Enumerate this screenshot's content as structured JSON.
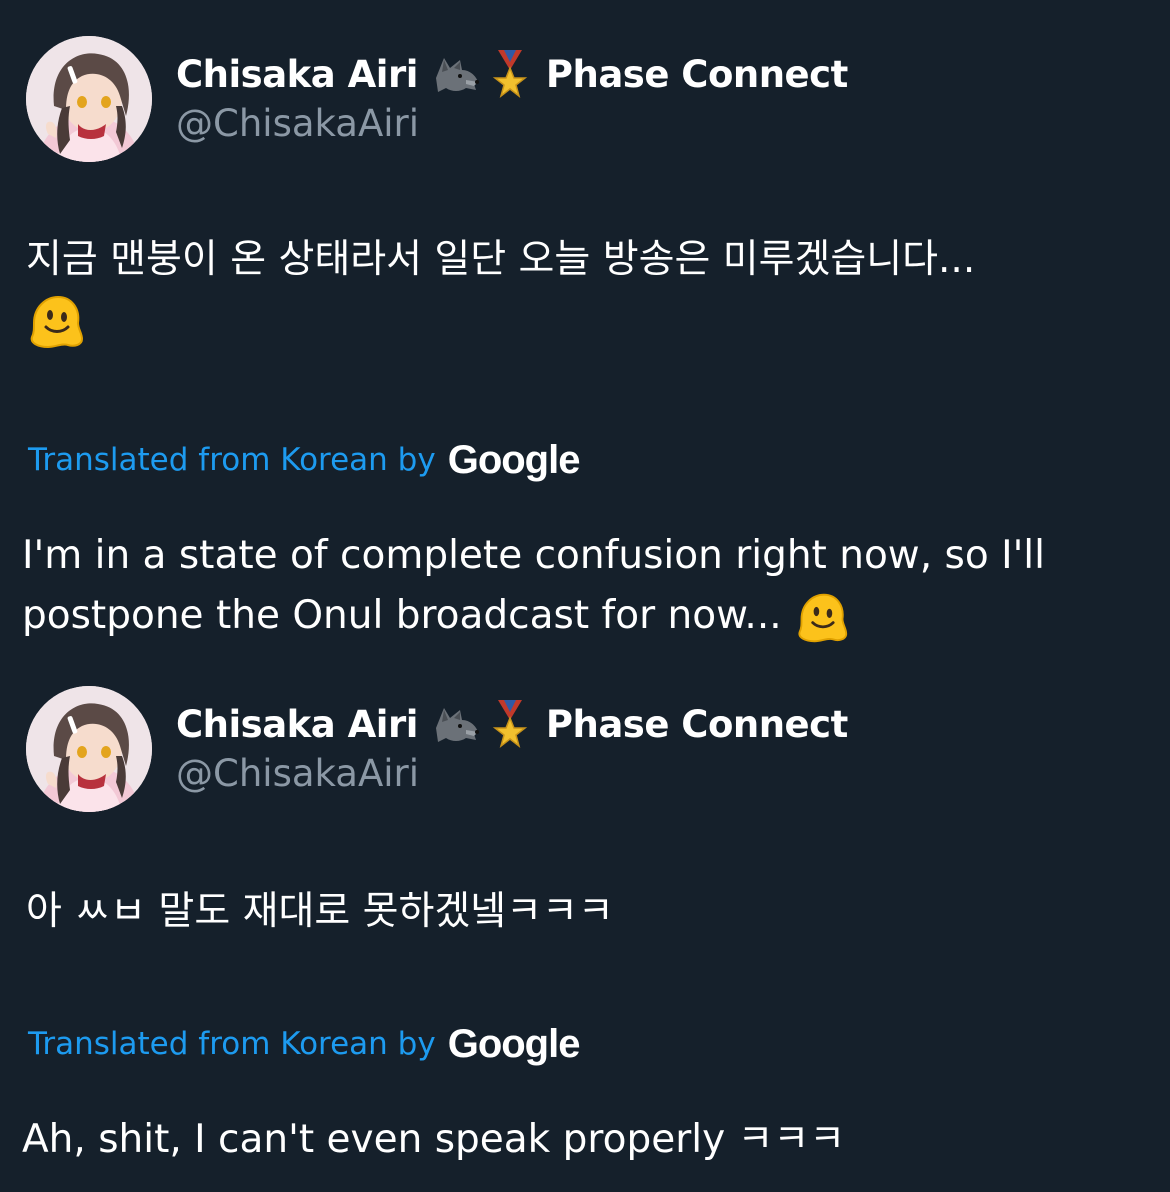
{
  "tweets": [
    {
      "author": {
        "display_name": "Chisaka Airi",
        "badge_icons": [
          "wolf-emoji-icon",
          "military-medal-icon"
        ],
        "affiliation": "Phase Connect",
        "handle": "@ChisakaAiri"
      },
      "original_text": "지금 맨붕이 온 상태라서 일단 오늘 방송은 미루겠습니다...",
      "original_emoji": "melting-face-icon",
      "translation_label": "Translated from Korean by",
      "translation_provider": "Google",
      "translated_text": "I'm in a state of complete confusion right now, so I'll postpone the Onul broadcast for now...",
      "translated_emoji": "melting-face-icon"
    },
    {
      "author": {
        "display_name": "Chisaka Airi",
        "badge_icons": [
          "wolf-emoji-icon",
          "military-medal-icon"
        ],
        "affiliation": "Phase Connect",
        "handle": "@ChisakaAiri"
      },
      "original_text": "아 ㅆㅂ 말도 재대로 못하겠넼ㅋㅋㅋ",
      "translation_label": "Translated from Korean by",
      "translation_provider": "Google",
      "translated_text": "Ah, shit, I can't even speak properly ㅋㅋㅋ"
    }
  ],
  "colors": {
    "background": "#15202b",
    "primary_text": "#ffffff",
    "secondary_text": "#8b98a5",
    "link": "#1d9bf0"
  }
}
